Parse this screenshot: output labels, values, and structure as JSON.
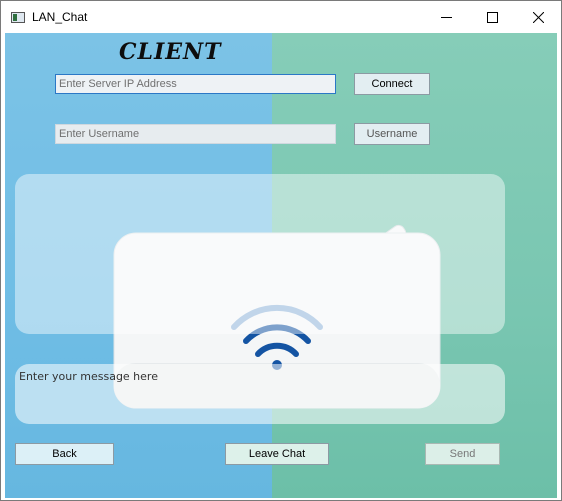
{
  "window": {
    "title": "LAN_Chat",
    "controls": {
      "minimize_icon": "minimize-icon",
      "maximize_icon": "maximize-icon",
      "close_icon": "close-icon"
    }
  },
  "header": {
    "heading": "CLIENT"
  },
  "server": {
    "ip_placeholder": "Enter Server IP Address",
    "ip_value": "",
    "connect_label": "Connect"
  },
  "user": {
    "username_placeholder": "Enter Username",
    "username_value": "",
    "username_label": "Username"
  },
  "chat": {
    "messages": []
  },
  "composer": {
    "message_placeholder": "Enter your message here",
    "message_value": ""
  },
  "footer": {
    "back_label": "Back",
    "leave_label": "Leave Chat",
    "send_label": "Send"
  },
  "colors": {
    "bg_left": "#6fbde5",
    "bg_right": "#79c6b1",
    "wifi_icon": "#1454a3",
    "focus_border": "#2b78c6"
  }
}
